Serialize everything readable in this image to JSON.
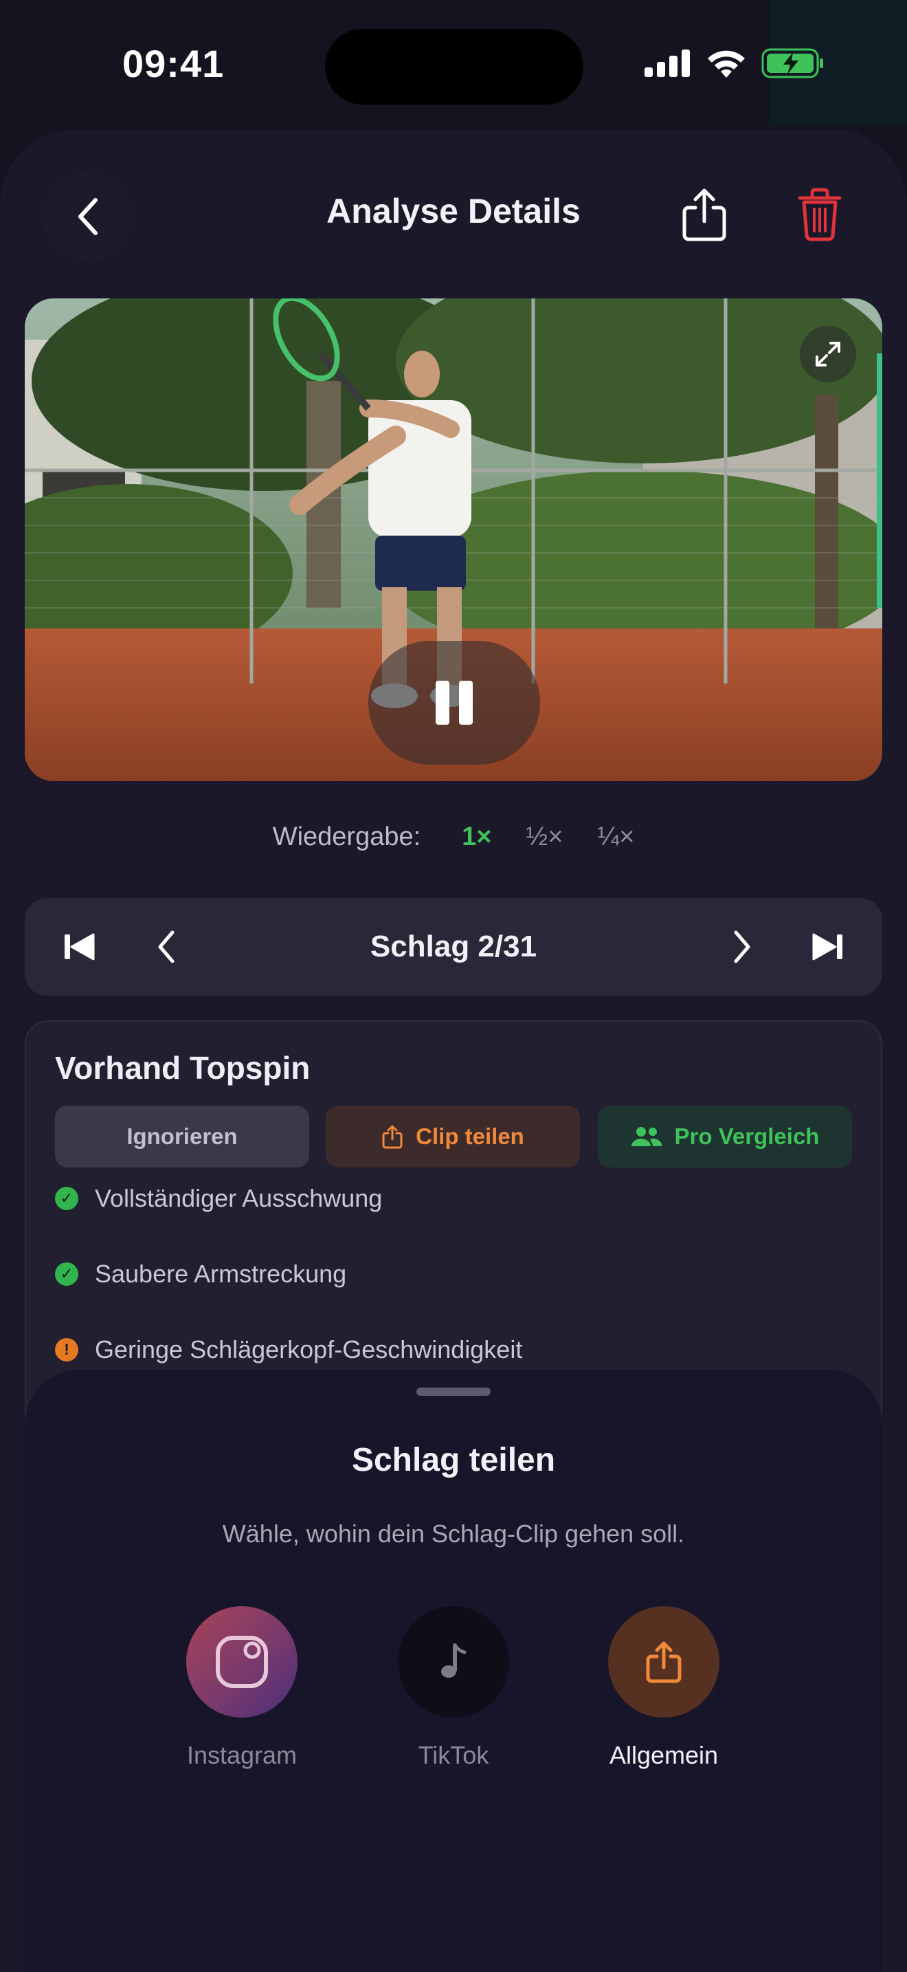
{
  "status": {
    "time": "09:41"
  },
  "header": {
    "title": "Analyse Details"
  },
  "playback": {
    "label": "Wiedergabe:",
    "speeds": [
      "1×",
      "½×",
      "¼×"
    ],
    "active_index": 0
  },
  "stroke_nav": {
    "title": "Schlag 2/31"
  },
  "analysis": {
    "stroke_type": "Vorhand Topspin",
    "buttons": {
      "ignore": "Ignorieren",
      "clip_share": "Clip teilen",
      "pro_compare": "Pro Vergleich"
    },
    "items": [
      {
        "text": "Vollständiger Ausschwung",
        "status": "ok"
      },
      {
        "text": "Saubere Armstreckung",
        "status": "ok"
      },
      {
        "text": "Geringe Schlägerkopf-Geschwindigkeit",
        "status": "warning"
      }
    ]
  },
  "share_sheet": {
    "title": "Schlag teilen",
    "subtitle": "Wähle, wohin dein Schlag-Clip gehen soll.",
    "options": [
      {
        "label": "Instagram",
        "icon": "instagram-icon"
      },
      {
        "label": "TikTok",
        "icon": "music-note-icon"
      },
      {
        "label": "Allgemein",
        "icon": "share-icon"
      }
    ]
  },
  "colors": {
    "accent_green": "#3fc259",
    "accent_orange": "#f08a3a",
    "danger_red": "#e0343d"
  }
}
